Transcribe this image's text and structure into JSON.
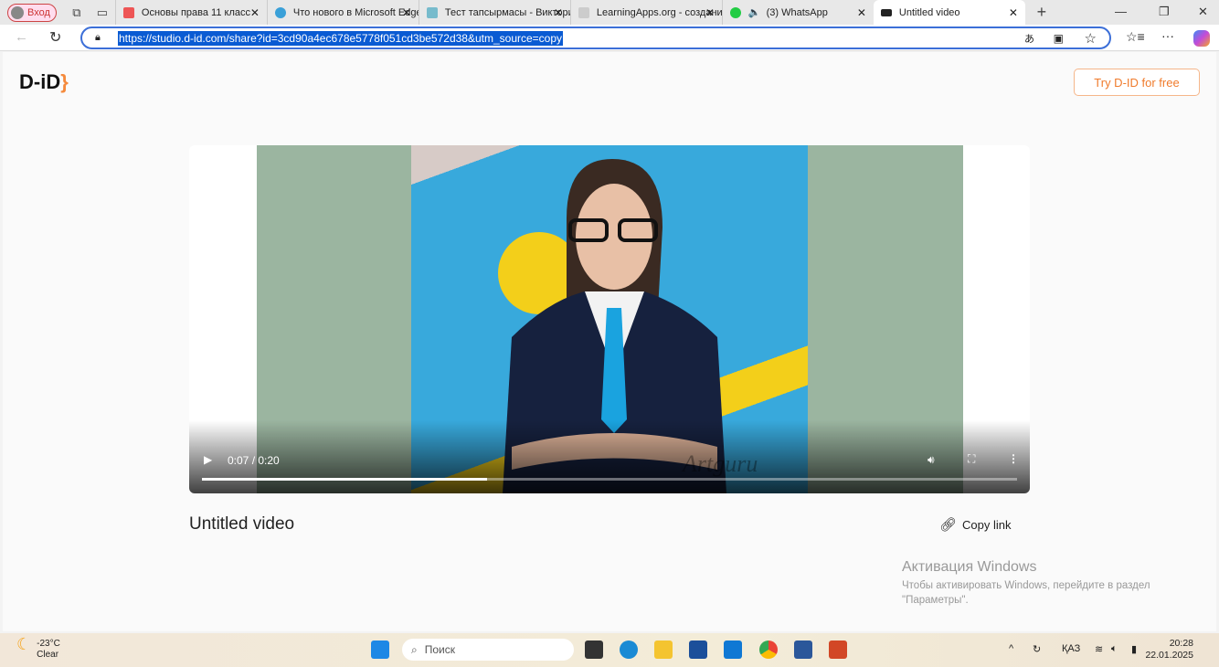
{
  "browser": {
    "profile_label": "Вход",
    "tabs": [
      {
        "label": "Основы права 11 класс",
        "icon": "pdf-icon",
        "color": "#e55"
      },
      {
        "label": "Что нового в Microsoft Edge",
        "icon": "edge-icon",
        "color": "#3aa0d8"
      },
      {
        "label": "Тест тапсырмасы - Викторина",
        "icon": "grid-icon",
        "color": "#7bc"
      },
      {
        "label": "LearningApps.org - создание",
        "icon": "learningapps-icon",
        "color": "#ccc"
      },
      {
        "label": "(3) WhatsApp",
        "icon": "whatsapp-icon",
        "color": "#2c4"
      },
      {
        "label": "Untitled video",
        "icon": "did-icon",
        "color": "#222"
      }
    ],
    "url": "https://studio.d-id.com/share?id=3cd90a4ec678e5778f051cd3be572d38&utm_source=copy"
  },
  "page": {
    "logo": "D-iD",
    "try_button": "Try D-ID for free",
    "video": {
      "time": "0:07 / 0:20",
      "progress_fraction": 0.35,
      "watermark": "Artguru",
      "bg_color": "#9bb5a0"
    },
    "video_title": "Untitled video",
    "copy_link": "Copy link"
  },
  "activation": {
    "heading": "Активация Windows",
    "text": "Чтобы активировать Windows, перейдите в раздел \"Параметры\"."
  },
  "taskbar": {
    "temp": "-23°C",
    "weather": "Clear",
    "search": "Поиск",
    "lang": "ҚАЗ",
    "time": "20:28",
    "date": "22.01.2025"
  }
}
